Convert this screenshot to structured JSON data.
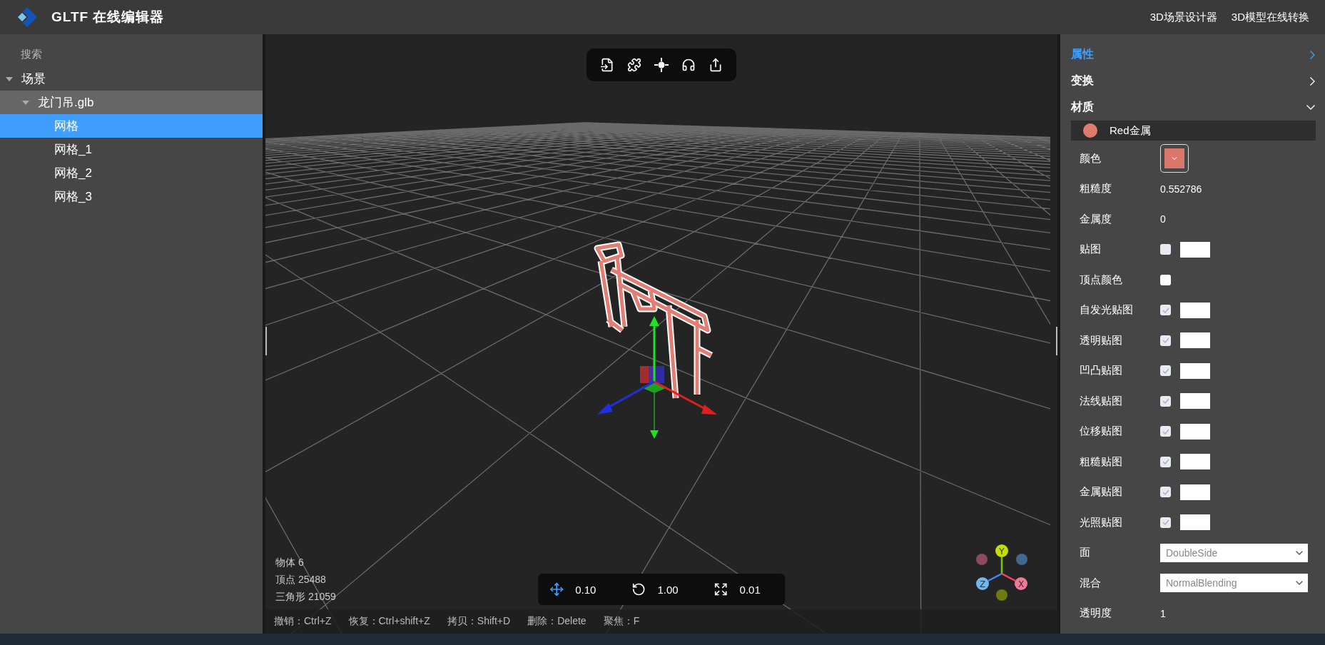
{
  "header": {
    "title": "GLTF 在线编辑器",
    "links": [
      "3D场景设计器",
      "3D模型在线转换"
    ]
  },
  "outline": {
    "search": {
      "placeholder": "搜索"
    },
    "tree": [
      {
        "label": "场景",
        "expanded": true,
        "highlighted": false,
        "selected": false,
        "children": [
          {
            "label": "龙门吊.glb",
            "expanded": true,
            "highlighted": true,
            "selected": false,
            "children": [
              {
                "label": "网格",
                "highlighted": false,
                "selected": true
              },
              {
                "label": "网格_1",
                "highlighted": false,
                "selected": false
              },
              {
                "label": "网格_2",
                "highlighted": false,
                "selected": false
              },
              {
                "label": "网格_3",
                "highlighted": false,
                "selected": false
              }
            ]
          }
        ]
      }
    ]
  },
  "viewport": {
    "stats": [
      "物体 6",
      "顶点 25488",
      "三角形 21059"
    ],
    "snap": [
      {
        "kind": "move",
        "value": "0.10"
      },
      {
        "kind": "rotate",
        "value": "1.00"
      },
      {
        "kind": "scale",
        "value": "0.01"
      }
    ],
    "shortcuts": [
      "撤销：Ctrl+Z",
      "恢复：Ctrl+shift+Z",
      "拷贝：Shift+D",
      "删除：Delete",
      "聚焦：F"
    ],
    "axes": [
      {
        "label": "Y",
        "color": "#c5e000"
      },
      {
        "label": "Z",
        "color": "#6cb8f5"
      },
      {
        "label": "X",
        "color": "#f2789a"
      }
    ]
  },
  "inspector": {
    "sections": [
      {
        "title": "属性",
        "selected": true,
        "expanded": false
      },
      {
        "title": "变换",
        "selected": false,
        "expanded": false
      },
      {
        "title": "材质",
        "selected": false,
        "expanded": true
      }
    ],
    "materials": [
      {
        "name": "Red金属",
        "color": "#e07b6c"
      }
    ],
    "properties": [
      {
        "kind": "color",
        "label": "颜色",
        "color": "#d9776b"
      },
      {
        "kind": "text",
        "label": "粗糙度",
        "value": "0.552786"
      },
      {
        "kind": "text",
        "label": "金属度",
        "value": "0"
      },
      {
        "kind": "texture",
        "label": "贴图",
        "checked": false,
        "disabled": true
      },
      {
        "kind": "checkbox",
        "label": "顶点颜色",
        "checked": false,
        "disabled": false
      },
      {
        "kind": "texture",
        "label": "自发光贴图",
        "checked": true,
        "disabled": true
      },
      {
        "kind": "texture",
        "label": "透明贴图",
        "checked": true,
        "disabled": true
      },
      {
        "kind": "texture",
        "label": "凹凸贴图",
        "checked": true,
        "disabled": true
      },
      {
        "kind": "texture",
        "label": "法线贴图",
        "checked": true,
        "disabled": true
      },
      {
        "kind": "texture",
        "label": "位移贴图",
        "checked": true,
        "disabled": true
      },
      {
        "kind": "texture",
        "label": "粗糙贴图",
        "checked": true,
        "disabled": true
      },
      {
        "kind": "texture",
        "label": "金属贴图",
        "checked": true,
        "disabled": true
      },
      {
        "kind": "texture",
        "label": "光照贴图",
        "checked": true,
        "disabled": true
      },
      {
        "kind": "select",
        "label": "面",
        "value": "DoubleSide"
      },
      {
        "kind": "select",
        "label": "混合",
        "value": "NormalBlending"
      },
      {
        "kind": "text",
        "label": "透明度",
        "value": "1"
      }
    ]
  }
}
